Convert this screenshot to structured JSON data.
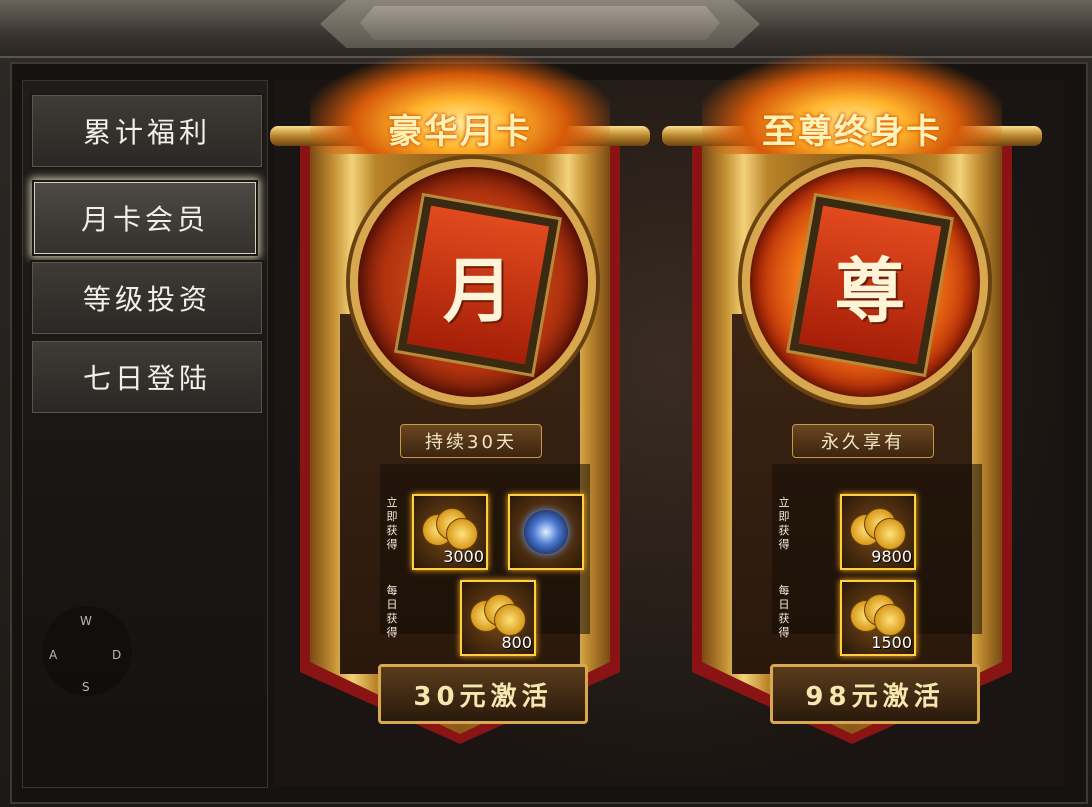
{
  "sidebar": {
    "tabs": [
      {
        "label": "累计福利"
      },
      {
        "label": "月卡会员"
      },
      {
        "label": "等级投资"
      },
      {
        "label": "七日登陆"
      }
    ],
    "active_tab": "月卡会员"
  },
  "joystick": {
    "w": "W",
    "a": "A",
    "s": "S",
    "d": "D"
  },
  "cards": [
    {
      "title": "豪华月卡",
      "emblem": "月",
      "duration": "持续30天",
      "immediate_label": "立即获得",
      "daily_label": "每日获得",
      "immediate_items": [
        {
          "icon": "gold-coins-icon",
          "amount": "3000"
        },
        {
          "icon": "blue-orb-icon",
          "amount": ""
        }
      ],
      "daily_items": [
        {
          "icon": "gold-coins-icon",
          "amount": "800"
        }
      ],
      "button": "30元激活"
    },
    {
      "title": "至尊终身卡",
      "emblem": "尊",
      "duration": "永久享有",
      "immediate_label": "立即获得",
      "daily_label": "每日获得",
      "immediate_items": [
        {
          "icon": "gold-coins-icon",
          "amount": "9800"
        }
      ],
      "daily_items": [
        {
          "icon": "gold-coins-icon",
          "amount": "1500"
        }
      ],
      "button": "98元激活"
    }
  ]
}
